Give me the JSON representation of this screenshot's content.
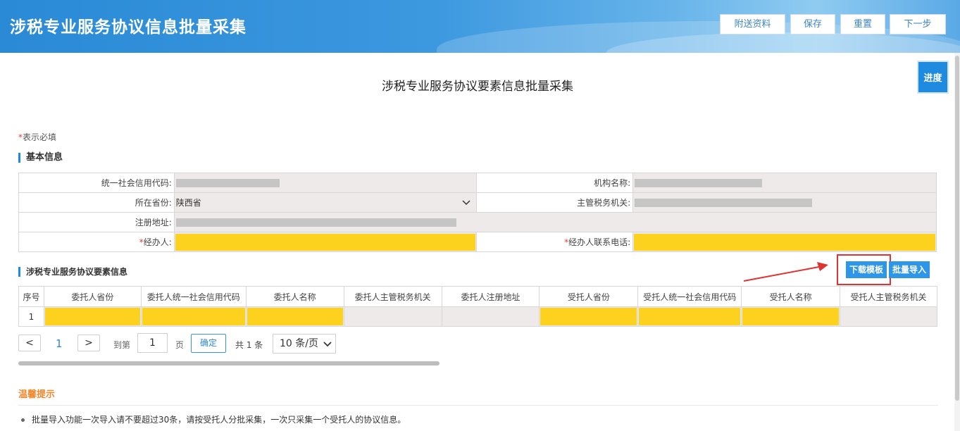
{
  "header": {
    "title": "涉税专业服务协议信息批量采集",
    "buttons": {
      "attach": "附送资料",
      "save": "保存",
      "reset": "重置",
      "next": "下一步"
    }
  },
  "progress_label": "进度",
  "page_title": "涉税专业服务协议要素信息批量采集",
  "required_note": {
    "star": "*",
    "text": "表示必填"
  },
  "basic_info": {
    "section_title": "基本信息",
    "credit_code_label": "统一社会信用代码:",
    "org_name_label": "机构名称:",
    "province_label": "所在省份:",
    "province_value": "陕西省",
    "tax_authority_label": "主管税务机关:",
    "address_label": "注册地址:",
    "handler_label": "经办人:",
    "handler_phone_label": "经办人联系电话:",
    "star": "*"
  },
  "elements": {
    "section_title": "涉税专业服务协议要素信息",
    "download_template": "下载模板",
    "batch_import": "批量导入",
    "columns": [
      "序号",
      "委托人省份",
      "委托人统一社会信用代码",
      "委托人名称",
      "委托人主管税务机关",
      "委托人注册地址",
      "受托人省份",
      "受托人统一社会信用代码",
      "受托人名称",
      "受托人主管税务机关"
    ],
    "rows": [
      {
        "index": "1"
      }
    ]
  },
  "pagination": {
    "prev": "<",
    "current_page": "1",
    "next": ">",
    "goto_label": "到第",
    "goto_value": "1",
    "page_unit": "页",
    "confirm": "确定",
    "total": "共 1 条",
    "page_size": "10 条/页"
  },
  "tips": {
    "title": "温馨提示",
    "items": [
      "批量导入功能一次导入请不要超过30条，请按受托人分批采集，一次只采集一个受托人的协议信息。"
    ]
  },
  "colors": {
    "primary": "#1e8ae0",
    "highlight_yellow": "#fdd21f",
    "annotation_red": "#e03333",
    "tip_orange": "#f0882e"
  }
}
